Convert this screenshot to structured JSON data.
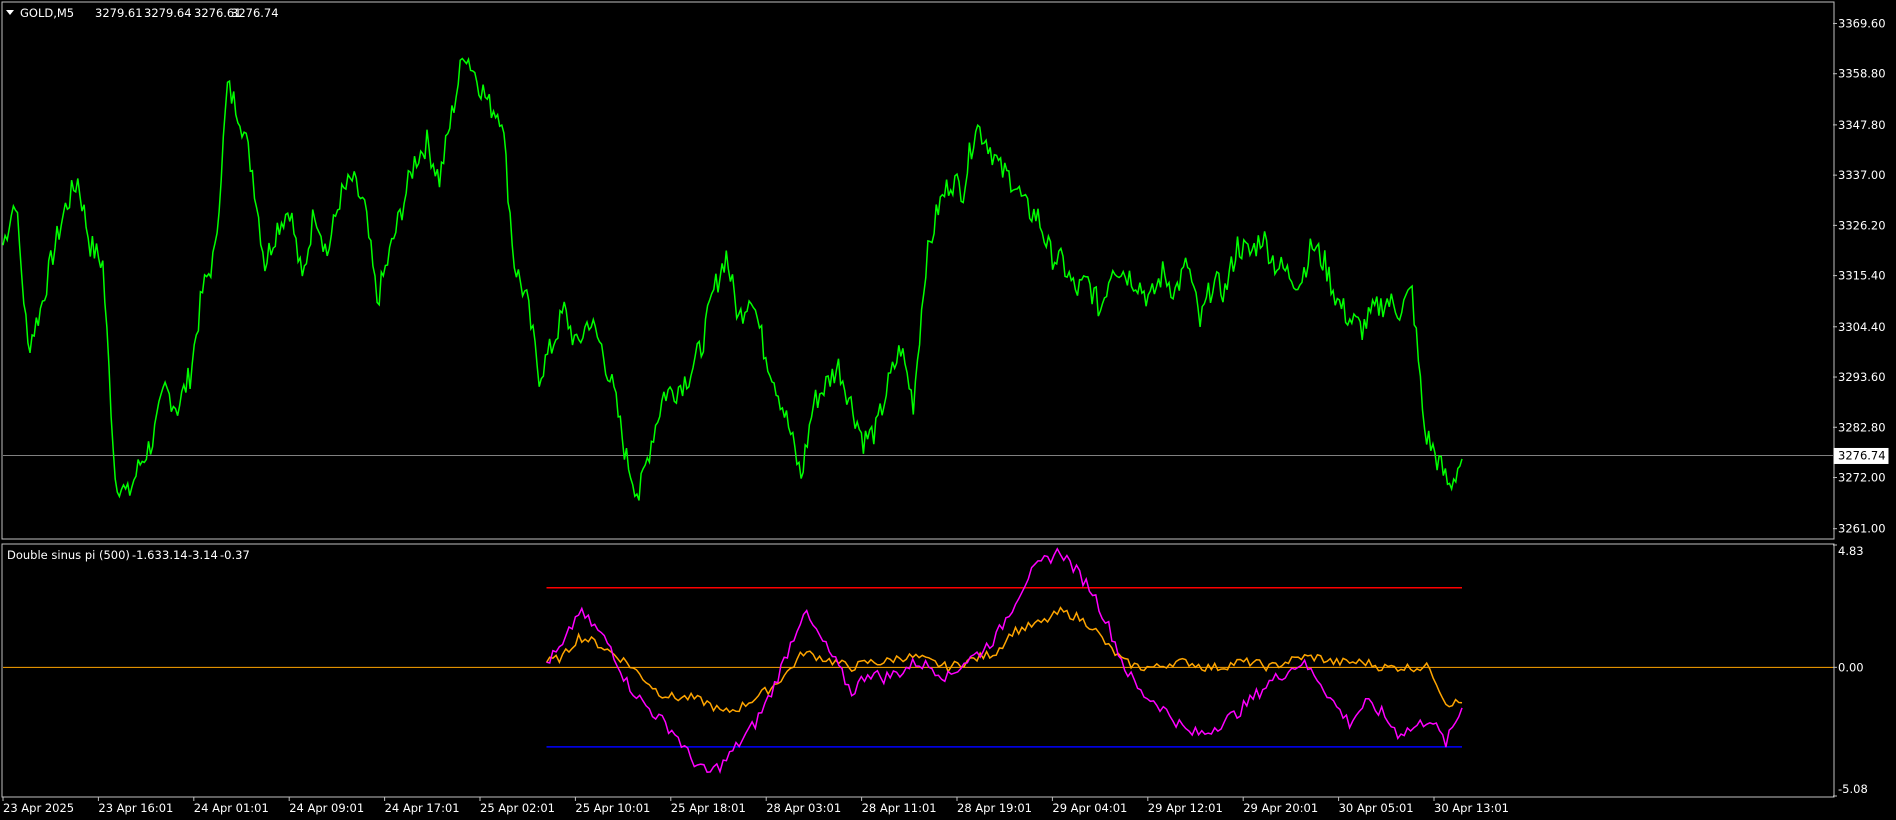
{
  "main_panel": {
    "header": {
      "symbol": "GOLD,M5",
      "open": "3279.61",
      "high": "3279.64",
      "low": "3276.61",
      "close": "3276.74"
    },
    "current_price": 3276.74,
    "current_price_label": "3276.74"
  },
  "indicator_panel": {
    "title": "Double sinus pi (500)",
    "values": [
      "-1.63",
      "3.14",
      "-3.14",
      "-0.37"
    ]
  },
  "colors": {
    "price_line": "#00ff00",
    "magenta_line": "#ff00ff",
    "orange_line": "#ffa500",
    "upper_level": "#ff0000",
    "lower_level": "#0000ff",
    "zero_level": "#ffa500",
    "grid_border": "#c0c0c0",
    "background": "#000000"
  },
  "chart_data": [
    {
      "type": "line",
      "series": [
        {
          "name": "GOLD,M5",
          "values": [
            3322,
            3332,
            3300,
            3308,
            3320,
            3330,
            3336,
            3322,
            3318,
            3272,
            3268,
            3275,
            3280,
            3291,
            3287,
            3294,
            3312,
            3320,
            3356,
            3350,
            3338,
            3318,
            3326,
            3330,
            3314,
            3330,
            3320,
            3332,
            3336,
            3330,
            3310,
            3320,
            3330,
            3340,
            3344,
            3336,
            3350,
            3364,
            3358,
            3352,
            3350,
            3318,
            3310,
            3294,
            3300,
            3308,
            3300,
            3306,
            3300,
            3290,
            3276,
            3268,
            3280,
            3290,
            3291,
            3294,
            3300,
            3312,
            3320,
            3306,
            3312,
            3300,
            3292,
            3283,
            3272,
            3288,
            3292,
            3296,
            3288,
            3280,
            3282,
            3292,
            3300,
            3288,
            3318,
            3330,
            3336,
            3334,
            3348,
            3344,
            3338,
            3336,
            3330,
            3328,
            3320,
            3318,
            3312,
            3314,
            3308,
            3318,
            3316,
            3314,
            3310,
            3316,
            3312,
            3318,
            3305,
            3314,
            3312,
            3322,
            3320,
            3324,
            3318,
            3316,
            3314,
            3322,
            3318,
            3310,
            3306,
            3304,
            3308,
            3310,
            3308,
            3312,
            3282,
            3276,
            3270,
            3276
          ]
        }
      ],
      "yticks": [
        3369.6,
        3358.8,
        3347.8,
        3337.0,
        3326.2,
        3315.4,
        3304.4,
        3293.6,
        3282.8,
        3272.0,
        3261.0
      ],
      "ytick_labels": [
        "3369.60",
        "3358.80",
        "3347.80",
        "3337.00",
        "3326.20",
        "3315.40",
        "3304.40",
        "3293.60",
        "3282.80",
        "3272.00",
        "3261.00"
      ],
      "ylim": [
        3259.0,
        3374.0
      ]
    },
    {
      "type": "line",
      "x_start_fraction": 0.297,
      "series": [
        {
          "name": "magenta",
          "values": [
            0.2,
            0.8,
            2.2,
            1.6,
            0.8,
            -0.6,
            -1.4,
            -2.0,
            -2.6,
            -3.6,
            -4.2,
            -3.8,
            -3.0,
            -2.2,
            -1.0,
            0.6,
            2.2,
            1.2,
            0.2,
            -1.0,
            -0.2,
            -0.4,
            -0.2,
            0.2,
            0.0,
            -0.4,
            0.2,
            0.6,
            1.2,
            2.4,
            3.6,
            4.2,
            4.6,
            3.8,
            3.0,
            1.6,
            0.0,
            -1.0,
            -1.4,
            -2.0,
            -2.6,
            -2.6,
            -2.2,
            -1.8,
            -1.2,
            -0.6,
            -0.2,
            0.2,
            -0.4,
            -1.4,
            -2.2,
            -1.4,
            -1.8,
            -2.6,
            -2.4,
            -2.0,
            -3.0,
            -1.6
          ],
          "color": "#ff00ff"
        },
        {
          "name": "orange",
          "values": [
            0.2,
            0.4,
            1.2,
            1.0,
            0.6,
            0.2,
            -0.4,
            -1.0,
            -1.2,
            -1.2,
            -1.4,
            -1.8,
            -1.6,
            -1.2,
            -0.8,
            -0.2,
            0.6,
            0.4,
            0.2,
            0.0,
            0.2,
            0.2,
            0.4,
            0.4,
            0.2,
            0.0,
            0.2,
            0.4,
            0.6,
            1.4,
            1.6,
            1.8,
            2.2,
            2.0,
            1.6,
            0.8,
            0.2,
            0.0,
            0.0,
            0.2,
            0.2,
            0.0,
            0.0,
            0.2,
            0.2,
            0.0,
            0.2,
            0.4,
            0.4,
            0.2,
            0.2,
            0.2,
            0.0,
            0.0,
            0.0,
            0.0,
            -1.4,
            -1.4
          ],
          "color": "#ffa500"
        }
      ],
      "levels": [
        3.14,
        0.0,
        -3.14
      ],
      "yticks": [
        4.83,
        0.0,
        -5.08
      ],
      "ytick_labels": [
        "4.83",
        "0.00",
        "-5.08"
      ],
      "ylim": [
        -5.08,
        4.83
      ]
    }
  ],
  "time_axis": {
    "labels": [
      "23 Apr 2025",
      "23 Apr 16:01",
      "24 Apr 01:01",
      "24 Apr 09:01",
      "24 Apr 17:01",
      "25 Apr 02:01",
      "25 Apr 10:01",
      "25 Apr 18:01",
      "28 Apr 03:01",
      "28 Apr 11:01",
      "28 Apr 19:01",
      "29 Apr 04:01",
      "29 Apr 12:01",
      "29 Apr 20:01",
      "30 Apr 05:01",
      "30 Apr 13:01"
    ]
  }
}
